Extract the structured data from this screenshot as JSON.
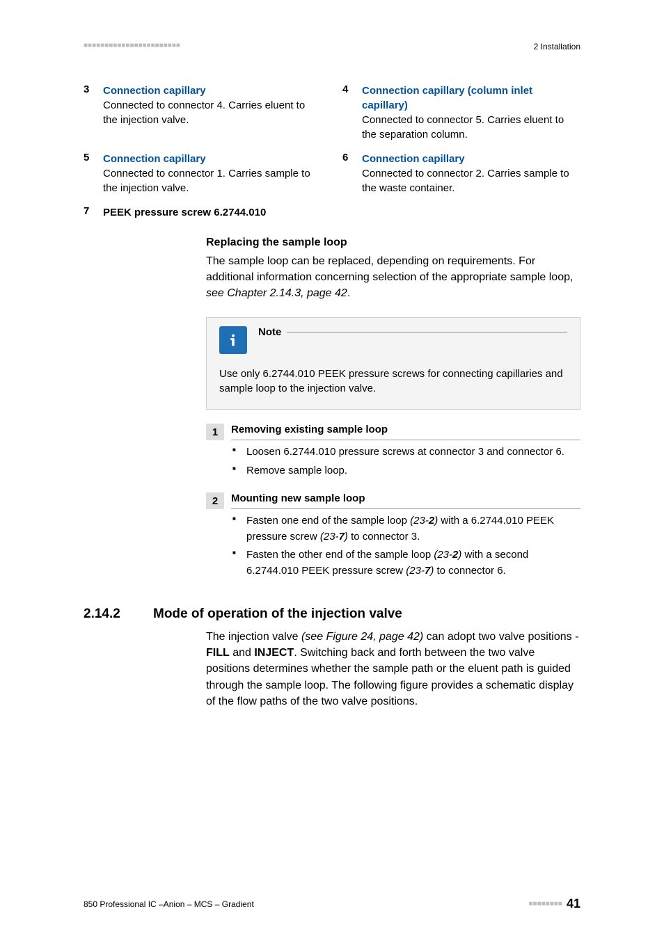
{
  "header": {
    "marks": "■■■■■■■■■■■■■■■■■■■■■■■",
    "breadcrumb": "2 Installation"
  },
  "legend": {
    "r1": {
      "left": {
        "num": "3",
        "title": "Connection capillary",
        "body": "Connected to connector 4. Carries eluent to the injection valve."
      },
      "right": {
        "num": "4",
        "title": "Connection capillary (column inlet capillary)",
        "body": "Connected to connector 5. Carries eluent to the separation column."
      }
    },
    "r2": {
      "left": {
        "num": "5",
        "title": "Connection capillary",
        "body": "Connected to connector 1. Carries sample to the injection valve."
      },
      "right": {
        "num": "6",
        "title": "Connection capillary",
        "body": "Connected to connector 2. Carries sample to the waste container."
      }
    },
    "r3": {
      "left": {
        "num": "7",
        "title": "PEEK pressure screw 6.2744.010",
        "body": ""
      }
    }
  },
  "replacing": {
    "heading": "Replacing the sample loop",
    "para_a": "The sample loop can be replaced, depending on requirements. For additional information concerning selection of the appropriate sample loop, ",
    "para_link": "see Chapter 2.14.3, page 42",
    "para_end": "."
  },
  "note": {
    "label": "Note",
    "body": "Use only 6.2744.010 PEEK pressure screws for connecting capillaries and sample loop to the injection valve."
  },
  "steps": {
    "s1": {
      "num": "1",
      "title": "Removing existing sample loop",
      "b1": "Loosen 6.2744.010 pressure screws at connector 3 and connector 6.",
      "b2": "Remove sample loop."
    },
    "s2": {
      "num": "2",
      "title": "Mounting new sample loop",
      "b1a": "Fasten one end of the sample loop ",
      "b1b": "(23-",
      "b1c": "2",
      "b1d": ")",
      "b1e": " with a 6.2744.010 PEEK pressure screw ",
      "b1f": "(23-",
      "b1g": "7",
      "b1h": ")",
      "b1i": " to connector 3.",
      "b2a": "Fasten the other end of the sample loop ",
      "b2b": "(23-",
      "b2c": "2",
      "b2d": ")",
      "b2e": " with a second 6.2744.010 PEEK pressure screw ",
      "b2f": "(23-",
      "b2g": "7",
      "b2h": ")",
      "b2i": " to connector 6."
    }
  },
  "chapter": {
    "num": "2.14.2",
    "title": "Mode of operation of the injection valve",
    "body_a": "The injection valve ",
    "body_ref": "(see Figure 24, page 42)",
    "body_b": " can adopt two valve positions - ",
    "fill": "FILL",
    "and": " and ",
    "inject": "INJECT",
    "body_c": ". Switching back and forth between the two valve positions determines whether the sample path or the eluent path is guided through the sample loop. The following figure provides a schematic display of the flow paths of the two valve positions."
  },
  "footer": {
    "left": "850 Professional IC –Anion – MCS – Gradient",
    "marks": "■■■■■■■■",
    "page": "41"
  }
}
